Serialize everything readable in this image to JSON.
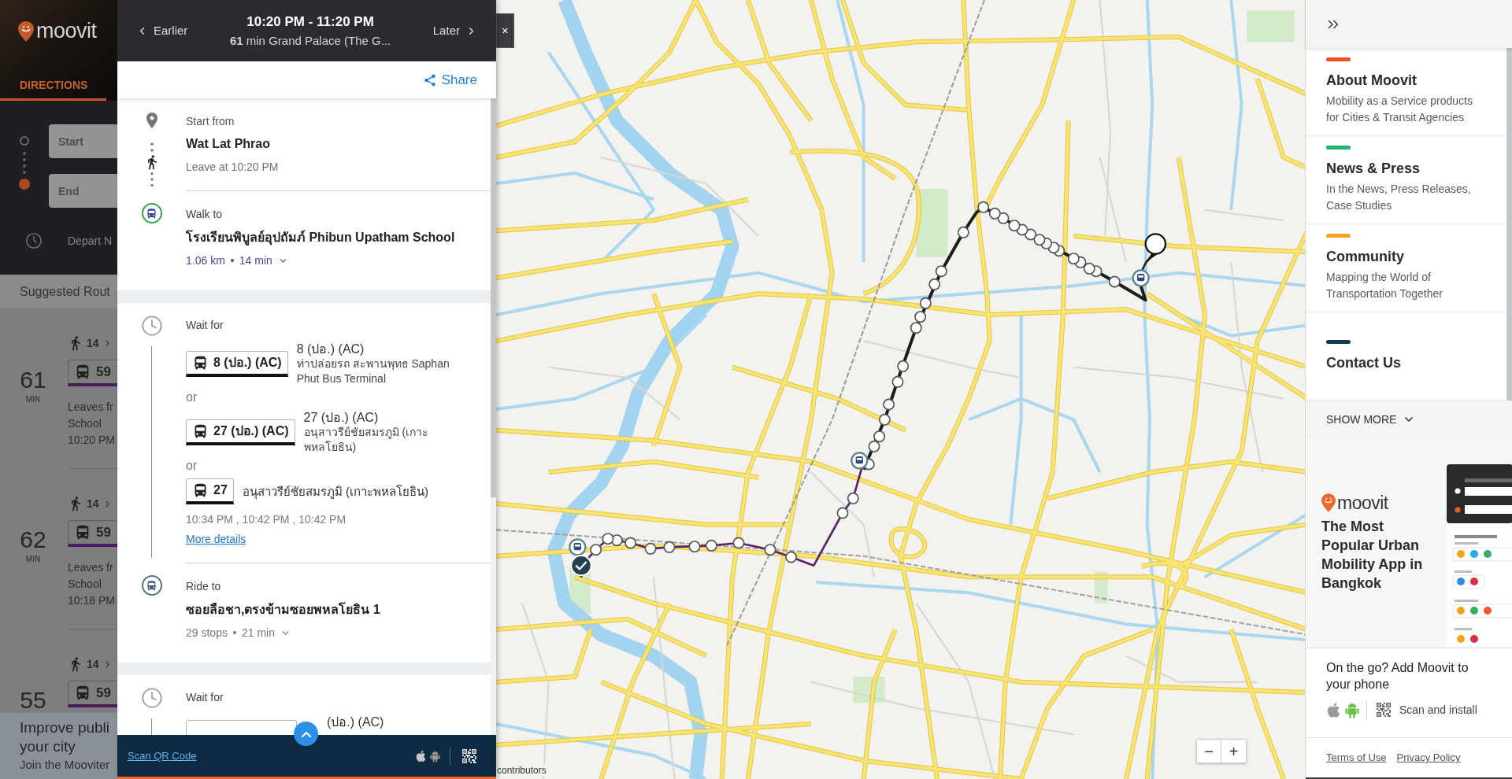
{
  "background_app": {
    "logo": "moovit",
    "tabs": [
      {
        "label": "DIRECTIONS",
        "selected": true
      }
    ],
    "start_field": {
      "placeholder": "Start"
    },
    "end_field": {
      "placeholder": "End"
    },
    "depart": "Depart N",
    "suggested_title": "Suggested Rout",
    "routes": [
      {
        "duration": "61",
        "unit": "MIN",
        "walk": "14",
        "line": "59",
        "leaves": "Leaves fr",
        "stop": "School",
        "time": "10:20 PM"
      },
      {
        "duration": "62",
        "unit": "MIN",
        "walk": "14",
        "line": "59",
        "leaves": "Leaves fr",
        "stop": "School",
        "time": "10:18 PM"
      },
      {
        "duration": "55",
        "walk": "14",
        "line": "59"
      }
    ],
    "banner": {
      "lines": [
        "Improve publi",
        "your city"
      ],
      "subtitle": "Join the Mooviter"
    }
  },
  "route_panel": {
    "close": "×",
    "header": {
      "earlier": "Earlier",
      "time_range": "10:20 PM - 11:20 PM",
      "summary": "**61** min Grand Palace (The G...",
      "later": "Later"
    },
    "share": "Share",
    "sections": [
      {
        "steps": [
          {
            "kind": "origin",
            "label": "Start from",
            "place": "Wat Lat Phrao",
            "note": "Leave at 10:20 PM"
          },
          {
            "kind": "walk",
            "label": "Walk to",
            "place": "โรงเรียนพิบูลย์อุปถัมภ์ Phibun Upatham School",
            "distance": "1.06 km",
            "duration": "14 min"
          }
        ]
      },
      {
        "steps": [
          {
            "kind": "wait",
            "label": "Wait for",
            "options": [
              {
                "line": "8 (ปอ.) (AC)",
                "name": "8 (ปอ.) (AC)",
                "direction": "ท่าปล่อยรถ สะพานพุทธ Saphan Phut Bus Terminal"
              },
              {
                "prefix": "or",
                "line": "27 (ปอ.) (AC)",
                "name": "27 (ปอ.) (AC)",
                "direction": "อนุสาวรีย์ชัยสมรภูมิ (เกาะพหลโยธิน)"
              },
              {
                "prefix": "or",
                "line": "27",
                "direction": "อนุสาวรีย์ชัยสมรภูมิ (เกาะพหลโยธิน)"
              }
            ],
            "departures": "10:34 PM , 10:42 PM , 10:42 PM",
            "link": "More details"
          },
          {
            "kind": "ride",
            "label": "Ride to",
            "place": "ซอยลือชา,ตรงข้ามซอยพหลโยธิน 1",
            "distance": "29 stops",
            "duration": "21 min"
          }
        ]
      },
      {
        "steps": [
          {
            "kind": "wait",
            "label": "Wait for",
            "options": [
              {
                "name": "(ปอ.) (AC)"
              }
            ]
          }
        ]
      }
    ],
    "footer": {
      "link": "Scan QR Code"
    }
  },
  "map": {
    "zoom_out": "−",
    "zoom_in": "+",
    "attribution": "contributors"
  },
  "sidebar": {
    "links": [
      {
        "title": "About Moovit",
        "description": "Mobility as a Service products for Cities & Transit Agencies",
        "color": "#f04e23"
      },
      {
        "title": "News & Press",
        "description": "In the News, Press Releases, Case Studies",
        "color": "#1eb36b"
      },
      {
        "title": "Community",
        "description": "Mapping the World of Transportation Together",
        "color": "#f8a31b"
      },
      {
        "title": "Contact Us",
        "color": "#0f3b55"
      }
    ],
    "show_more": "SHOW MORE",
    "promo": {
      "logo": "moovit",
      "headline": "The Most Popular Urban Mobility App in Bangkok"
    },
    "app": {
      "title": "On the go? Add Moovit to your phone",
      "scan": "Scan and install"
    },
    "footer": [
      "Terms of Use",
      "Privacy Policy"
    ]
  }
}
